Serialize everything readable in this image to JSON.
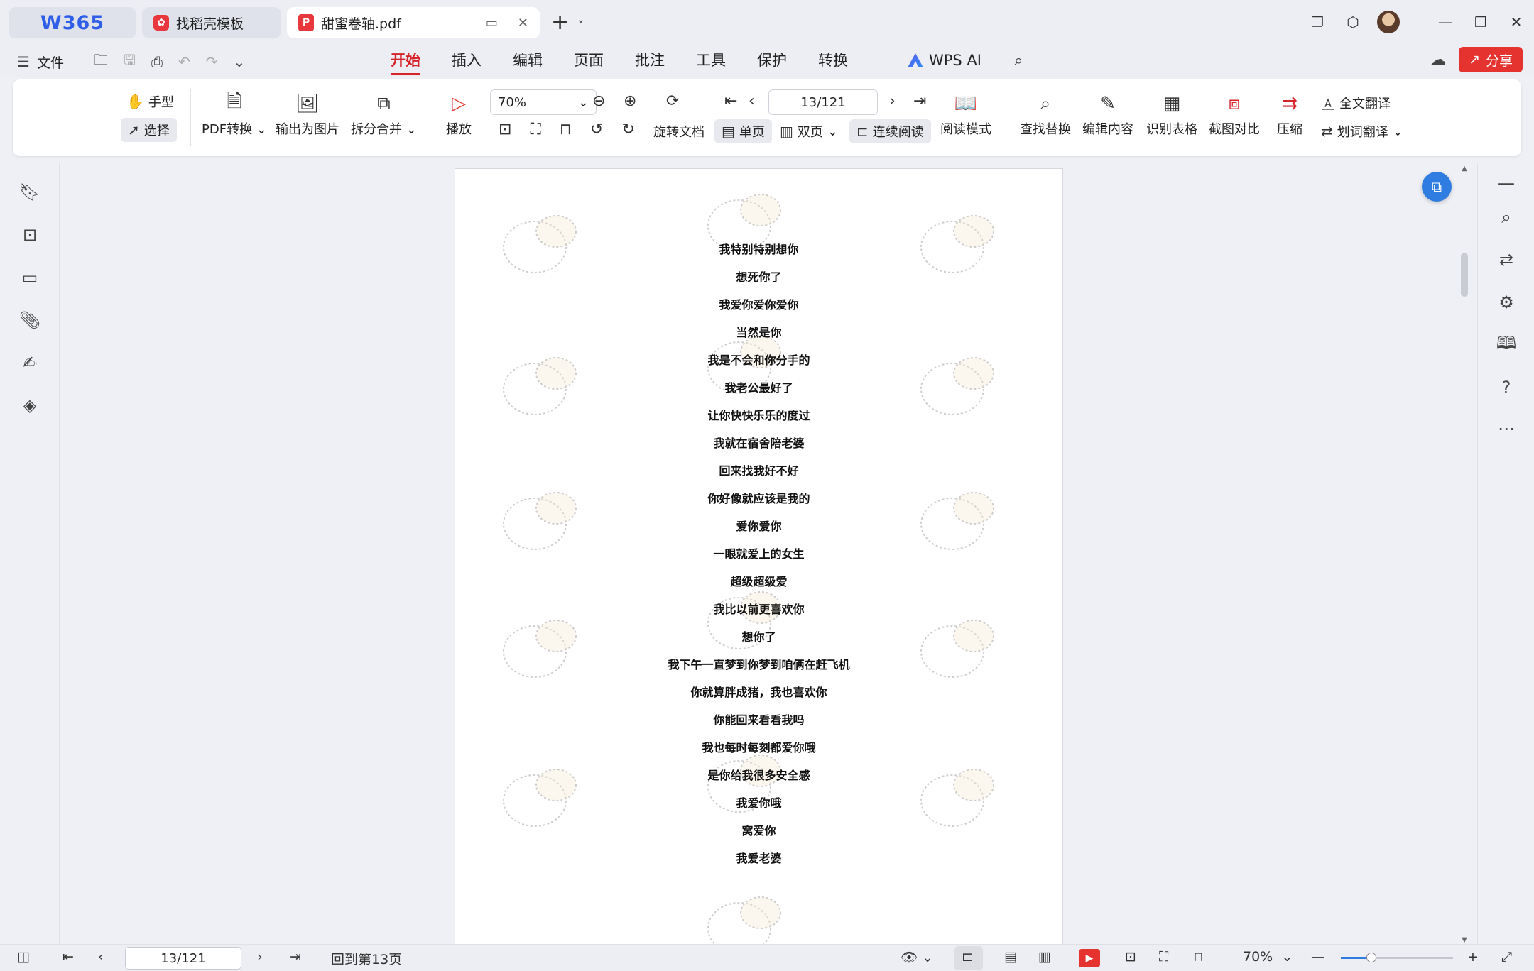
{
  "tabs": {
    "home_logo": "W365",
    "templates": "找稻壳模板",
    "document": "甜蜜卷轴.pdf"
  },
  "menu": {
    "file": "文件",
    "tabs": [
      "开始",
      "插入",
      "编辑",
      "页面",
      "批注",
      "工具",
      "保护",
      "转换"
    ],
    "active_tab": "开始",
    "wps_ai": "WPS AI",
    "share": "分享"
  },
  "ribbon": {
    "hand": "手型",
    "select": "选择",
    "pdf_convert": "PDF转换",
    "export_image": "输出为图片",
    "split_merge": "拆分合并",
    "play": "播放",
    "zoom_value": "70%",
    "page_value": "13/121",
    "rotate_doc": "旋转文档",
    "single_page": "单页",
    "double_page": "双页",
    "continuous": "连续阅读",
    "read_mode": "阅读模式",
    "find_replace": "查找替换",
    "edit_content": "编辑内容",
    "recognize_table": "识别表格",
    "screenshot_compare": "截图对比",
    "compress": "压缩",
    "full_translate": "全文翻译",
    "word_translate": "划词翻译"
  },
  "document": {
    "lines": [
      "我特别特别想你",
      "想死你了",
      "我爱你爱你爱你",
      "当然是你",
      "我是不会和你分手的",
      "我老公最好了",
      "让你快快乐乐的度过",
      "我就在宿舍陪老婆",
      "回来找我好不好",
      "你好像就应该是我的",
      "爱你爱你",
      "一眼就爱上的女生",
      "超级超级爱",
      "我比以前更喜欢你",
      "想你了",
      "我下午一直梦到你梦到咱俩在赶飞机",
      "你就算胖成猪，我也喜欢你",
      "你能回来看看我吗",
      "我也每时每刻都爱你哦",
      "是你给我很多安全感",
      "我爱你哦",
      "窝爱你",
      "我爱老婆"
    ]
  },
  "statusbar": {
    "page_value": "13/121",
    "goto": "回到第13页",
    "zoom": "70%",
    "zoom_fraction": 0.27
  },
  "colors": {
    "accent_red": "#d6232a",
    "brand_blue": "#2f5ee8",
    "share_red": "#e5342f"
  }
}
